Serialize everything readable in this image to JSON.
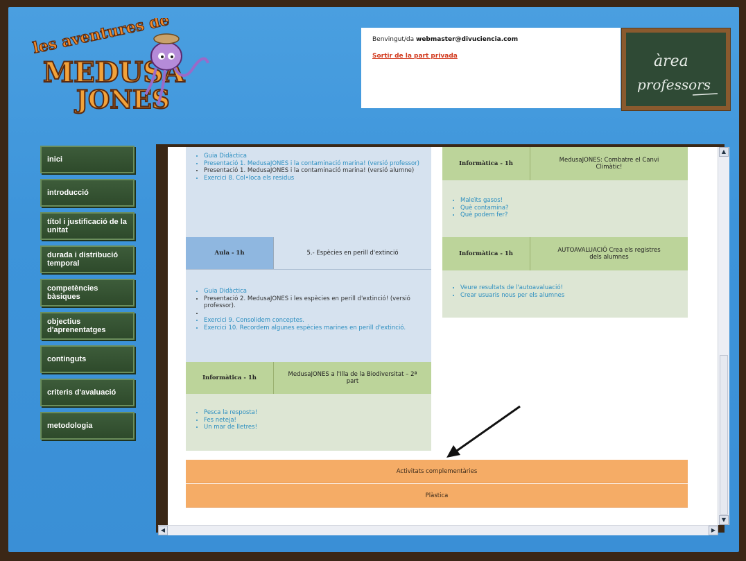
{
  "header": {
    "welcome_prefix": "Benvingut/da ",
    "welcome_user": "webmaster@divuciencia.com",
    "logout_link": "Sortir de la part privada",
    "logo_text_top": "les aventures de",
    "logo_text_mid": "MEDUSA",
    "logo_text_bot": "JONES",
    "board_line1": "àrea",
    "board_line2": "professors"
  },
  "sidebar": {
    "items": [
      {
        "label": "inici"
      },
      {
        "label": "introducció"
      },
      {
        "label": "títol i justificació de la unitat"
      },
      {
        "label": "durada i distribució temporal"
      },
      {
        "label": "competències bàsiques"
      },
      {
        "label": "objectius d'aprenentatges"
      },
      {
        "label": "continguts"
      },
      {
        "label": "criteris d'avaluació"
      },
      {
        "label": "metodologia"
      }
    ]
  },
  "left_column": {
    "block1": {
      "items": [
        {
          "text": "Guia Didàctica",
          "link": true
        },
        {
          "text": "Presentació 1. MedusaJONES i la contaminació marina! (versió professor)",
          "link": true
        },
        {
          "text": "Presentació 1. MedusaJONES i la contaminació marina! (versió alumne)",
          "link": false
        },
        {
          "text": "Exercici 8. Col•loca els residus",
          "link": true
        }
      ]
    },
    "header2": {
      "left": "Aula - 1h",
      "right": "5.- Espècies en perill d'extinció"
    },
    "block2": {
      "items": [
        {
          "text": "Guia Didàctica",
          "link": true
        },
        {
          "text": "Presentació 2. MedusaJONES i les espècies en perill d'extinció! (versió professor).",
          "link": false
        },
        {
          "text": "",
          "link": false
        },
        {
          "text": "Exercici 9. Consolidem conceptes.",
          "link": true
        },
        {
          "text": "Exercici 10. Recordem algunes espècies marines en perill d'extinció.",
          "link": true
        }
      ]
    },
    "header3": {
      "left": "Informàtica - 1h",
      "right": "MedusaJONES a l'Illa de la Biodiversitat – 2ª part"
    },
    "block3": {
      "items": [
        {
          "text": "Pesca la resposta!",
          "link": true
        },
        {
          "text": "Fes neteja!",
          "link": true
        },
        {
          "text": "Un mar de lletres!",
          "link": true
        }
      ]
    }
  },
  "right_column": {
    "header1": {
      "left": "Informàtica - 1h",
      "right": "MedusaJONES: Combatre el Canvi Climàtic!"
    },
    "block1": {
      "items": [
        {
          "text": "Maleïts gasos!",
          "link": true
        },
        {
          "text": "Què contamina?",
          "link": true
        },
        {
          "text": "Què podem fer?",
          "link": true
        }
      ]
    },
    "header2": {
      "left": "Informàtica - 1h",
      "right": "AUTOAVALUACIÓ Crea els registres dels alumnes"
    },
    "block2": {
      "items": [
        {
          "text": "Veure resultats de l'autoavaluació!",
          "link": true
        },
        {
          "text": "Crear usuaris nous per els alumnes",
          "link": true
        }
      ]
    }
  },
  "bottom": {
    "activities_label": "Activitats complementàries",
    "plastica_label": "Plàstica"
  },
  "colors": {
    "blue_bg": "#3d94da",
    "nav_green": "#3d5c3a",
    "header_green": "#bcd49a",
    "header_blue": "#8fb7e0",
    "content_blue": "#d6e2ef",
    "content_green": "#dde6d4",
    "orange": "#f5ac66"
  }
}
